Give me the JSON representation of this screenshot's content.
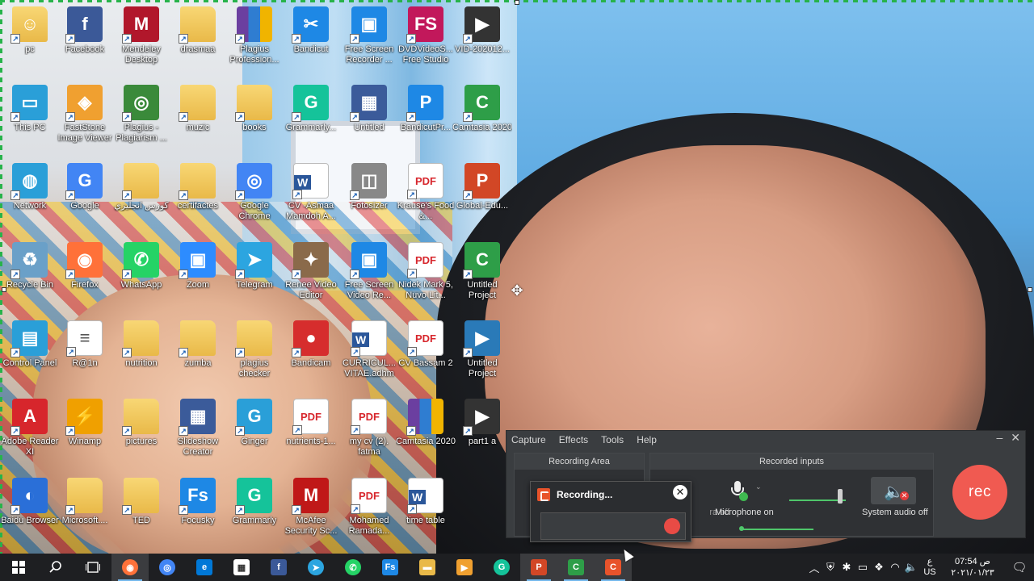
{
  "desktop": {
    "icons": [
      {
        "label": "pc",
        "glyph": "person-folder-icon",
        "color": "#e9b949"
      },
      {
        "label": "Facebook",
        "glyph": "facebook-icon",
        "color": "#3b5998"
      },
      {
        "label": "Mendeley Desktop",
        "glyph": "mendeley-icon",
        "color": "#b1172b"
      },
      {
        "label": "drasmaa",
        "glyph": "folder-icon",
        "color": "#e9b949"
      },
      {
        "label": "Plagius Profession...",
        "glyph": "winrar-icon",
        "color": "#6b3fa0"
      },
      {
        "label": "Bandicut",
        "glyph": "bandicut-icon",
        "color": "#1e88e5"
      },
      {
        "label": "Free Screen Recorder ...",
        "glyph": "screen-recorder-icon",
        "color": "#1e88e5"
      },
      {
        "label": "DVDVideoS... Free Studio",
        "glyph": "fs-icon",
        "color": "#c2185b"
      },
      {
        "label": "VID-202012...",
        "glyph": "video-file-icon",
        "color": "#333333"
      },
      {
        "label": "This PC",
        "glyph": "computer-icon",
        "color": "#2a9fd8"
      },
      {
        "label": "FastStone Image Viewer",
        "glyph": "faststone-icon",
        "color": "#f0a030"
      },
      {
        "label": "Plagius - Plagiarism ...",
        "glyph": "plagius-icon",
        "color": "#3a8a3a"
      },
      {
        "label": "muzic",
        "glyph": "folder-icon",
        "color": "#e9b949"
      },
      {
        "label": "books",
        "glyph": "folder-icon",
        "color": "#e9b949"
      },
      {
        "label": "Grammarly...",
        "glyph": "grammarly-icon",
        "color": "#15c39a"
      },
      {
        "label": "Untitled",
        "glyph": "bandicam-project-icon",
        "color": "#3b5b9a"
      },
      {
        "label": "BandicutPr...",
        "glyph": "bandicut-project-icon",
        "color": "#1e88e5"
      },
      {
        "label": "Camtasia 2020",
        "glyph": "camtasia-icon",
        "color": "#2e9e48"
      },
      {
        "label": "Network",
        "glyph": "network-icon",
        "color": "#2a9fd8"
      },
      {
        "label": "Google",
        "glyph": "google-icon",
        "color": "#4285f4"
      },
      {
        "label": "كورس انجليزي",
        "glyph": "folder-icon",
        "color": "#e9b949"
      },
      {
        "label": "certifactes",
        "glyph": "folder-icon",
        "color": "#e9b949"
      },
      {
        "label": "Google Chrome",
        "glyph": "chrome-icon",
        "color": "#4285f4"
      },
      {
        "label": "CV -Asmaa Mamdoh A...",
        "glyph": "word-icon",
        "color": "#2b579a"
      },
      {
        "label": "Fotosizer",
        "glyph": "fotosizer-icon",
        "color": "#888888"
      },
      {
        "label": "Krause's Food &...",
        "glyph": "pdf-icon",
        "color": "#d7262c"
      },
      {
        "label": "Global-Edu...",
        "glyph": "powerpoint-icon",
        "color": "#d24726"
      },
      {
        "label": "Recycle Bin",
        "glyph": "recycle-bin-icon",
        "color": "#6aa0c8"
      },
      {
        "label": "Firefox",
        "glyph": "firefox-icon",
        "color": "#ff7139"
      },
      {
        "label": "WhatsApp",
        "glyph": "whatsapp-icon",
        "color": "#25d366"
      },
      {
        "label": "Zoom",
        "glyph": "zoom-icon",
        "color": "#2d8cff"
      },
      {
        "label": "Telegram",
        "glyph": "telegram-icon",
        "color": "#2ca5e0"
      },
      {
        "label": "Renee Video Editor",
        "glyph": "renee-icon",
        "color": "#8a6a4a"
      },
      {
        "label": "Free Screen Video Re...",
        "glyph": "screen-video-icon",
        "color": "#1e88e5"
      },
      {
        "label": "Nidek Mark 5, Nuvo Lit...",
        "glyph": "pdf-icon",
        "color": "#d7262c"
      },
      {
        "label": "Untitled Project",
        "glyph": "camtasia-project-icon",
        "color": "#2e9e48"
      },
      {
        "label": "Control Panel",
        "glyph": "control-panel-icon",
        "color": "#2a9fd8"
      },
      {
        "label": "R@1n",
        "glyph": "text-file-icon",
        "color": "#ffffff"
      },
      {
        "label": "nutrition",
        "glyph": "folder-icon",
        "color": "#e9b949"
      },
      {
        "label": "zumba",
        "glyph": "folder-icon",
        "color": "#e9b949"
      },
      {
        "label": "plagius checker",
        "glyph": "folder-icon",
        "color": "#e9b949"
      },
      {
        "label": "Bandicam",
        "glyph": "bandicam-icon",
        "color": "#d62d2d"
      },
      {
        "label": "CURRICUL... VITAE.adhm",
        "glyph": "word-icon",
        "color": "#2b579a"
      },
      {
        "label": "CV Bassam 2",
        "glyph": "pdf-icon",
        "color": "#d7262c"
      },
      {
        "label": "Untitled Project",
        "glyph": "video-project-icon",
        "color": "#2a7ab8"
      },
      {
        "label": "Adobe Reader XI",
        "glyph": "adobe-reader-icon",
        "color": "#d7262c"
      },
      {
        "label": "Winamp",
        "glyph": "winamp-icon",
        "color": "#f0a000"
      },
      {
        "label": "pictures",
        "glyph": "folder-icon",
        "color": "#e9b949"
      },
      {
        "label": "Slideshow Creator",
        "glyph": "slideshow-icon",
        "color": "#3b5b9a"
      },
      {
        "label": "Ginger",
        "glyph": "ginger-icon",
        "color": "#2a9fd8"
      },
      {
        "label": "nutrients-1...",
        "glyph": "pdf-icon",
        "color": "#d7262c"
      },
      {
        "label": "my cv (2). fatma",
        "glyph": "pdf-icon",
        "color": "#d7262c"
      },
      {
        "label": "Camtasia 2020",
        "glyph": "winrar-icon",
        "color": "#6b3fa0"
      },
      {
        "label": "part1 a",
        "glyph": "video-file-icon",
        "color": "#333333"
      },
      {
        "label": "Baidu Browser",
        "glyph": "baidu-icon",
        "color": "#2a6fd8"
      },
      {
        "label": "Microsoft....",
        "glyph": "folder-icon",
        "color": "#e9b949"
      },
      {
        "label": "TED",
        "glyph": "folder-icon",
        "color": "#e9b949"
      },
      {
        "label": "Focusky",
        "glyph": "focusky-icon",
        "color": "#1e88e5"
      },
      {
        "label": "Grammarly",
        "glyph": "grammarly-icon",
        "color": "#15c39a"
      },
      {
        "label": "McAfee Security Sc...",
        "glyph": "mcafee-icon",
        "color": "#c01818"
      },
      {
        "label": "Mohamed Ramada...",
        "glyph": "pdf-icon",
        "color": "#d7262c"
      },
      {
        "label": "time table",
        "glyph": "word-icon",
        "color": "#2b579a"
      }
    ]
  },
  "recorder": {
    "menu": [
      "Capture",
      "Effects",
      "Tools",
      "Help"
    ],
    "recording_area_title": "Recording Area",
    "recorded_inputs_title": "Recorded inputs",
    "camera_label": "Camera off",
    "microphone_label": "Microphone on",
    "system_audio_label": "System audio off",
    "rec_label": "rec",
    "mic_volume": 0.9,
    "colors": {
      "rec": "#f05a51",
      "panel": "#3a3d40",
      "active_green": "#4fc66a"
    }
  },
  "popup": {
    "title": "Recording...",
    "close": "✕"
  },
  "taskbar": {
    "apps": [
      {
        "name": "firefox",
        "glyph": "firefox-icon",
        "color": "#ff7139",
        "active": true
      },
      {
        "name": "chrome",
        "glyph": "chrome-icon",
        "color": "#4285f4",
        "active": false
      },
      {
        "name": "edge",
        "glyph": "edge-icon",
        "color": "#0078d7",
        "active": false
      },
      {
        "name": "store",
        "glyph": "store-icon",
        "color": "#ffffff",
        "active": false
      },
      {
        "name": "facebook",
        "glyph": "facebook-icon",
        "color": "#3b5998",
        "active": false
      },
      {
        "name": "telegram",
        "glyph": "telegram-icon",
        "color": "#2ca5e0",
        "active": false
      },
      {
        "name": "whatsapp",
        "glyph": "whatsapp-icon",
        "color": "#25d366",
        "active": false
      },
      {
        "name": "focusky",
        "glyph": "focusky-icon",
        "color": "#1e88e5",
        "active": false
      },
      {
        "name": "file-explorer",
        "glyph": "folder-icon",
        "color": "#e9b949",
        "active": false
      },
      {
        "name": "video-player",
        "glyph": "video-player-icon",
        "color": "#f0a030",
        "active": false
      },
      {
        "name": "grammarly",
        "glyph": "grammarly-icon",
        "color": "#15c39a",
        "active": false
      },
      {
        "name": "powerpoint",
        "glyph": "powerpoint-icon",
        "color": "#d24726",
        "active": true
      },
      {
        "name": "camtasia",
        "glyph": "camtasia-icon",
        "color": "#2e9e48",
        "active": true
      },
      {
        "name": "camtasia-recorder",
        "glyph": "camtasia-recorder-icon",
        "color": "#e8532b",
        "active": true
      }
    ],
    "lang_top": "ع",
    "lang_bottom": "US",
    "time": "07:54 ص",
    "date": "٢٠٢١/٠١/٢٣"
  }
}
